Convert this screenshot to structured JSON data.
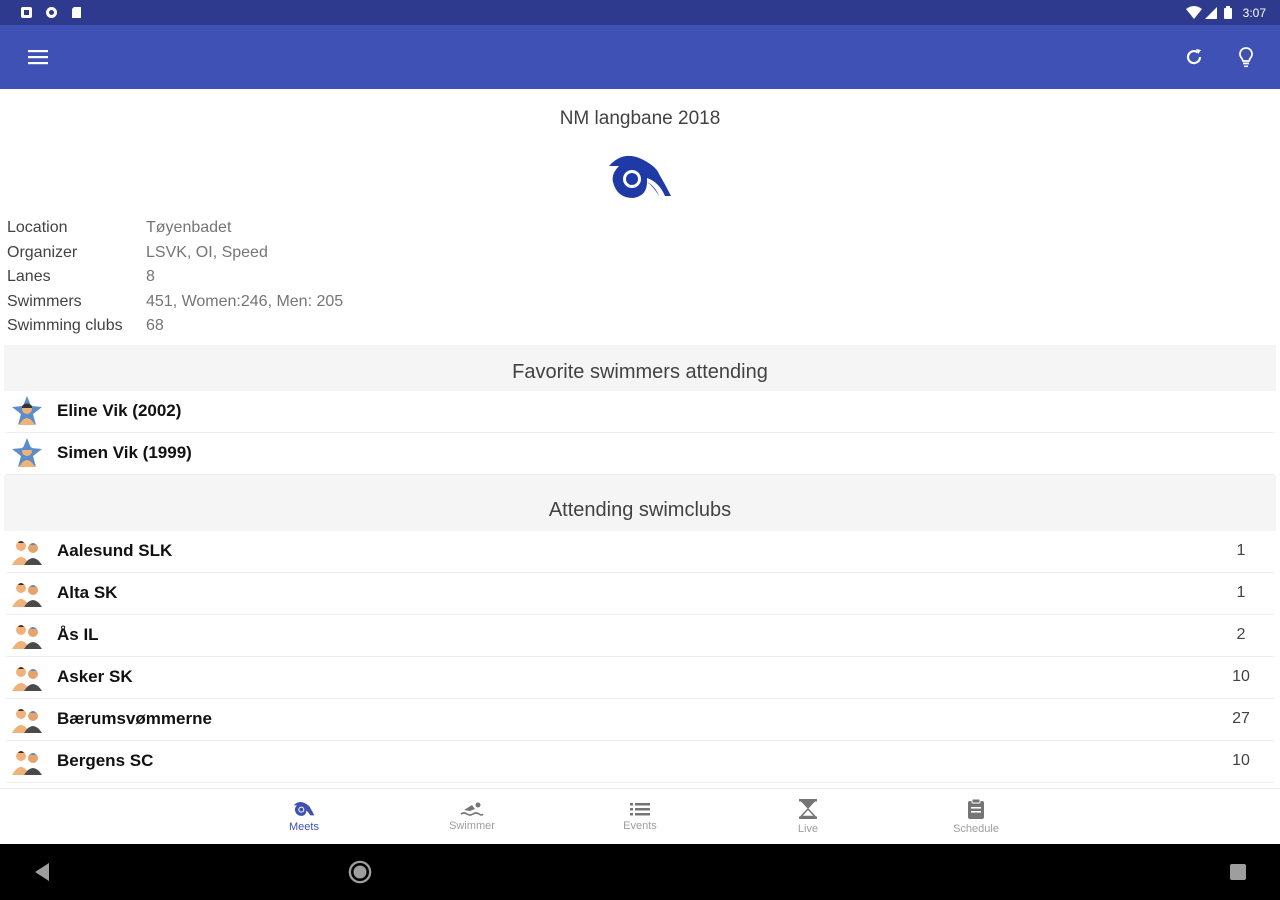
{
  "status_bar": {
    "time": "3:07"
  },
  "meet": {
    "title": "NM langbane 2018",
    "info": [
      {
        "label": "Location",
        "value": "Tøyenbadet"
      },
      {
        "label": "Organizer",
        "value": "LSVK, OI, Speed"
      },
      {
        "label": "Lanes",
        "value": "8"
      },
      {
        "label": "Swimmers",
        "value": "451, Women:246, Men: 205"
      },
      {
        "label": "Swimming clubs",
        "value": "68"
      }
    ]
  },
  "favorites": {
    "header": "Favorite swimmers attending",
    "items": [
      {
        "name": "Eline Vik (2002)"
      },
      {
        "name": "Simen Vik (1999)"
      }
    ]
  },
  "clubs": {
    "header": "Attending swimclubs",
    "items": [
      {
        "name": "Aalesund SLK",
        "count": "1"
      },
      {
        "name": "Alta SK",
        "count": "1"
      },
      {
        "name": "Ås IL",
        "count": "2"
      },
      {
        "name": "Asker SK",
        "count": "10"
      },
      {
        "name": "Bærumsvømmerne",
        "count": "27"
      },
      {
        "name": "Bergens SC",
        "count": "10"
      }
    ]
  },
  "bottom_nav": [
    {
      "label": "Meets",
      "icon": "swim-logo-icon",
      "active": true
    },
    {
      "label": "Swimmer",
      "icon": "swimmer-icon",
      "active": false
    },
    {
      "label": "Events",
      "icon": "list-icon",
      "active": false
    },
    {
      "label": "Live",
      "icon": "hourglass-icon",
      "active": false
    },
    {
      "label": "Schedule",
      "icon": "clipboard-icon",
      "active": false
    }
  ],
  "colors": {
    "primary": "#3f51b5",
    "primary_dark": "#2d3a8e",
    "logo": "#1f3aa6"
  }
}
